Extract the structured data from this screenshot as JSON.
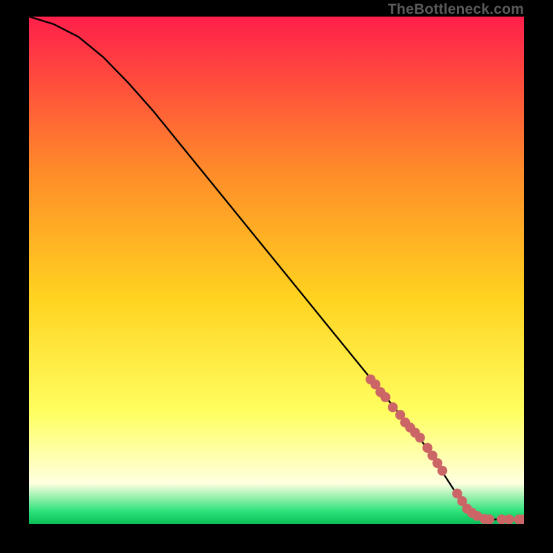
{
  "attribution": "TheBottleneck.com",
  "colors": {
    "gradient_top": "#ff1f4b",
    "gradient_mid_upper": "#ff8a2a",
    "gradient_mid": "#ffd21f",
    "gradient_mid_lower": "#ffff60",
    "gradient_lower_pale": "#ffffe0",
    "gradient_green": "#2ee27a",
    "curve": "#000000",
    "marker": "#cc6666",
    "frame": "#000000"
  },
  "chart_data": {
    "type": "line",
    "title": "",
    "xlabel": "",
    "ylabel": "",
    "xlim": [
      0,
      100
    ],
    "ylim": [
      0,
      100
    ],
    "series": [
      {
        "name": "curve",
        "x": [
          0,
          5,
          10,
          15,
          20,
          25,
          30,
          35,
          40,
          45,
          50,
          55,
          60,
          65,
          70,
          75,
          80,
          82,
          84,
          86,
          88,
          90,
          92,
          94,
          96,
          98,
          100
        ],
        "y": [
          100,
          98.5,
          96,
          92,
          87,
          81.5,
          75.5,
          69.5,
          63.5,
          57.5,
          51.5,
          45.5,
          39.5,
          33.5,
          27.5,
          21.5,
          15.5,
          12.5,
          9.5,
          6.5,
          3.5,
          1.5,
          1.0,
          0.9,
          0.9,
          0.9,
          0.9
        ]
      }
    ],
    "markers": {
      "name": "highlighted-points",
      "x": [
        69,
        70,
        71,
        72,
        73.5,
        75,
        76,
        77,
        78,
        79,
        80.5,
        81.5,
        82.5,
        83.5,
        86.5,
        87.5,
        88.5,
        89.5,
        90.5,
        92,
        93,
        95.5,
        97,
        99,
        100
      ],
      "y": [
        28.5,
        27.5,
        26,
        25,
        23,
        21.5,
        20,
        19,
        18,
        17,
        15,
        13.5,
        12,
        10.5,
        6,
        4.5,
        3,
        2.2,
        1.6,
        1.0,
        0.9,
        0.9,
        0.9,
        0.9,
        0.9
      ]
    }
  }
}
